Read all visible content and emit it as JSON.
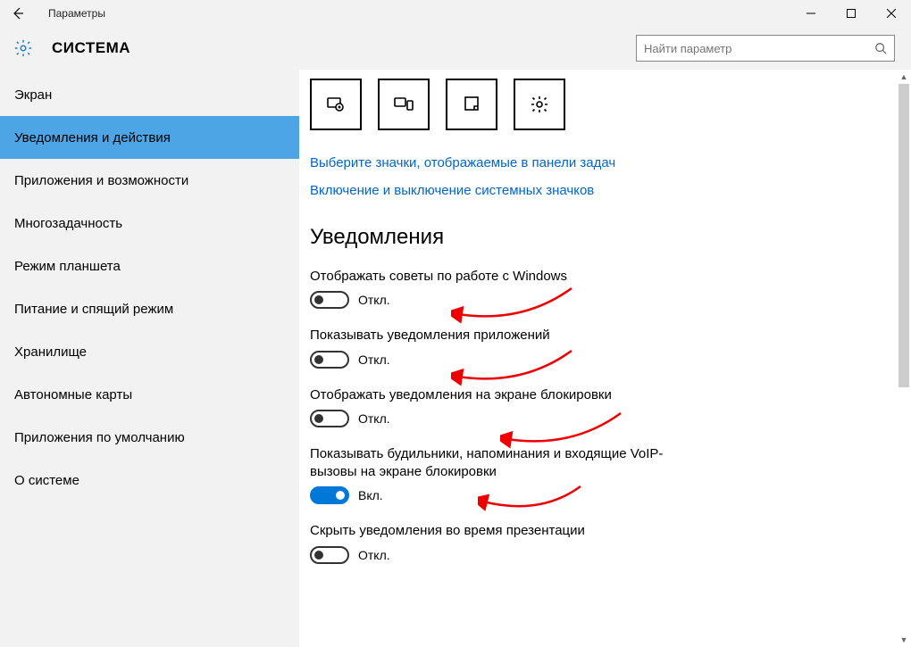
{
  "titlebar": {
    "title": "Параметры"
  },
  "header": {
    "title": "СИСТЕМА",
    "search_placeholder": "Найти параметр"
  },
  "sidebar": {
    "items": [
      {
        "label": "Экран"
      },
      {
        "label": "Уведомления и действия"
      },
      {
        "label": "Приложения и возможности"
      },
      {
        "label": "Многозадачность"
      },
      {
        "label": "Режим планшета"
      },
      {
        "label": "Питание и спящий режим"
      },
      {
        "label": "Хранилище"
      },
      {
        "label": "Автономные карты"
      },
      {
        "label": "Приложения по умолчанию"
      },
      {
        "label": "О системе"
      }
    ],
    "selected_index": 1
  },
  "links": {
    "taskbar_icons": "Выберите значки, отображаемые в панели задач",
    "system_icons": "Включение и выключение системных значков"
  },
  "notifications": {
    "heading": "Уведомления",
    "settings": [
      {
        "label": "Отображать советы по работе с Windows",
        "state": "Откл.",
        "on": false
      },
      {
        "label": "Показывать уведомления приложений",
        "state": "Откл.",
        "on": false
      },
      {
        "label": "Отображать уведомления на экране блокировки",
        "state": "Откл.",
        "on": false
      },
      {
        "label": "Показывать будильники, напоминания и входящие VoIP-вызовы на экране блокировки",
        "state": "Вкл.",
        "on": true
      },
      {
        "label": "Скрыть уведомления во время презентации",
        "state": "Откл.",
        "on": false
      }
    ]
  }
}
